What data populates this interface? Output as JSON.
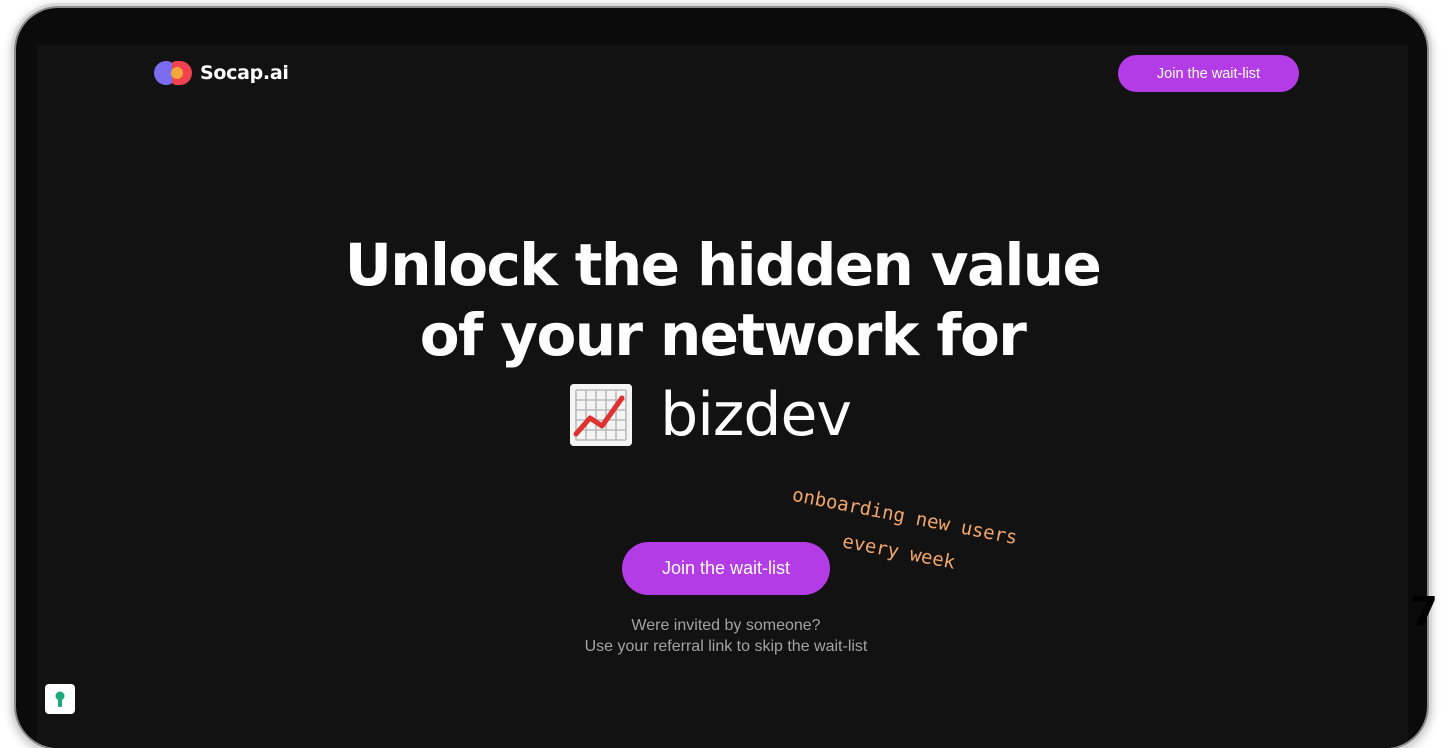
{
  "brand": {
    "name": "Socap.ai",
    "logo_icon": "socap-logo-icon",
    "colors": {
      "accent": "#b43ce6",
      "background": "#121212",
      "annotation": "#f2a66a"
    }
  },
  "nav": {
    "cta_label": "Join the wait-list"
  },
  "hero": {
    "headline_line1": "Unlock the hidden value",
    "headline_line2": "of your network for",
    "rotating_word": "bizdev",
    "rotating_icon": "chart-increasing-icon"
  },
  "annotation": {
    "line1": "onboarding new users",
    "line2": "every week"
  },
  "cta": {
    "label": "Join the wait-list"
  },
  "referral": {
    "line1": "Were invited by someone?",
    "line2": "Use your referral link to skip the wait-list"
  },
  "corner_glyph": "7",
  "badge_icon": "keyhole-icon"
}
